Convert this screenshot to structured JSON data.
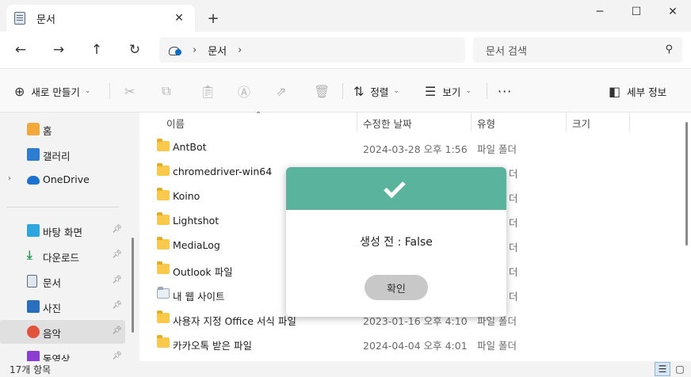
{
  "tab": {
    "title": "문서",
    "close": "✕",
    "new": "+"
  },
  "window": {
    "minimize": "─",
    "maximize": "☐",
    "close": "✕"
  },
  "address": {
    "sep": "›",
    "path": "문서",
    "trail": "›"
  },
  "search": {
    "placeholder": "문서 검색"
  },
  "toolbar": {
    "new_label": "새로 만들기",
    "sort_label": "정렬",
    "view_label": "보기",
    "more": "···",
    "details_label": "세부 정보"
  },
  "sidebar": {
    "items": [
      {
        "label": "홈"
      },
      {
        "label": "갤러리"
      },
      {
        "label": "OneDrive"
      },
      {
        "label": "바탕 화면"
      },
      {
        "label": "다운로드"
      },
      {
        "label": "문서"
      },
      {
        "label": "사진"
      },
      {
        "label": "음악"
      },
      {
        "label": "동영상"
      }
    ]
  },
  "columns": {
    "name": "이름",
    "modified": "수정한 날짜",
    "type": "유형",
    "size": "크기"
  },
  "files": [
    {
      "name": "AntBot",
      "date": "2024-03-28 오후 1:56",
      "type": "파일 폴더"
    },
    {
      "name": "chromedriver-win64",
      "date": "",
      "type": "더"
    },
    {
      "name": "Koino",
      "date": "",
      "type": "더"
    },
    {
      "name": "Lightshot",
      "date": "",
      "type": "더"
    },
    {
      "name": "MediaLog",
      "date": "",
      "type": "더"
    },
    {
      "name": "Outlook 파일",
      "date": "",
      "type": "더"
    },
    {
      "name": "내 웹 사이트",
      "date": "",
      "type": "더"
    },
    {
      "name": "사용자 지정 Office 서식 파일",
      "date": "2023-01-16 오후 4:10",
      "type": "파일 폴더"
    },
    {
      "name": "카카오톡 받은 파일",
      "date": "2024-04-04 오후 4:01",
      "type": "파일 폴더"
    }
  ],
  "status": {
    "count": "17개 항목"
  },
  "dialog": {
    "message": "생성 전 : False",
    "confirm": "확인",
    "header_color": "#5ab39c"
  }
}
